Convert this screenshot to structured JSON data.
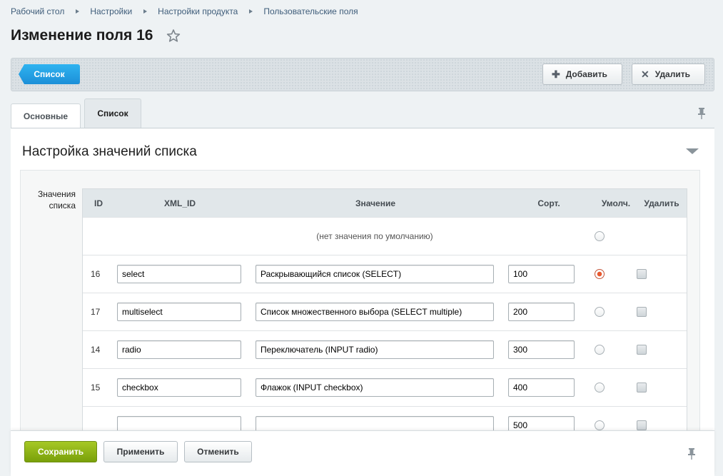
{
  "breadcrumb": [
    "Рабочий стол",
    "Настройки",
    "Настройки продукта",
    "Пользовательские поля"
  ],
  "title": "Изменение поля 16",
  "toolbar": {
    "list_label": "Список",
    "add_label": "Добавить",
    "delete_label": "Удалить"
  },
  "tabs": {
    "main": "Основные",
    "list": "Список"
  },
  "section": {
    "title": "Настройка значений списка",
    "values_label": "Значения списка"
  },
  "grid": {
    "headers": {
      "id": "ID",
      "xml_id": "XML_ID",
      "value": "Значение",
      "sort": "Сорт.",
      "default": "Умолч.",
      "delete": "Удалить"
    },
    "no_default_label": "(нет значения по умолчанию)",
    "rows": [
      {
        "id": "16",
        "xml_id": "select",
        "value": "Раскрывающийся список (SELECT)",
        "sort": "100",
        "default": true,
        "delete": false
      },
      {
        "id": "17",
        "xml_id": "multiselect",
        "value": "Список множественного выбора (SELECT multiple)",
        "sort": "200",
        "default": false,
        "delete": false
      },
      {
        "id": "14",
        "xml_id": "radio",
        "value": "Переключатель (INPUT radio)",
        "sort": "300",
        "default": false,
        "delete": false
      },
      {
        "id": "15",
        "xml_id": "checkbox",
        "value": "Флажок (INPUT checkbox)",
        "sort": "400",
        "default": false,
        "delete": false
      },
      {
        "id": "",
        "xml_id": "",
        "value": "",
        "sort": "500",
        "default": false,
        "delete": false
      }
    ]
  },
  "footer": {
    "save_label": "Сохранить",
    "apply_label": "Применить",
    "cancel_label": "Отменить"
  },
  "colors": {
    "accent_blue": "#1c8fd8",
    "save_green": "#79a00a",
    "radio_selected": "#e8582f"
  }
}
